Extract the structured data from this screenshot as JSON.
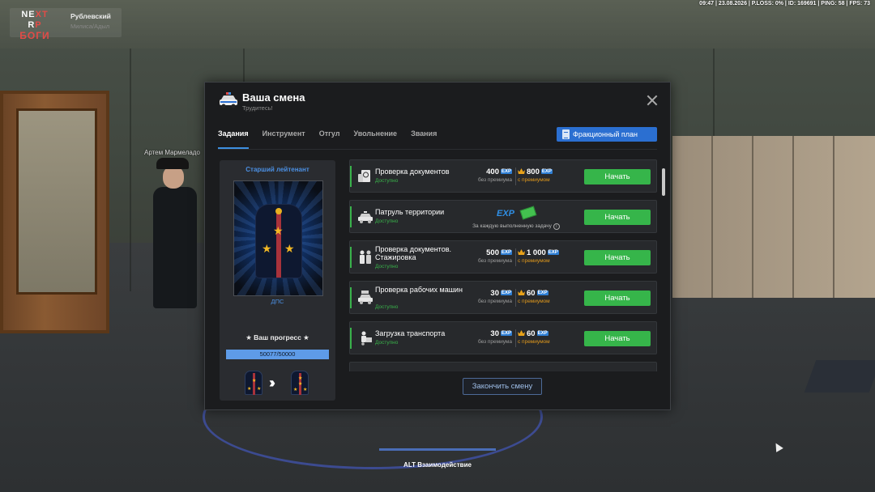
{
  "hud": {
    "status": "09:47 | 23.08.2026 | P.LOSS: 0% | ID: 169691 | PING: 58 | FPS: 73",
    "logo_top": "NEXT RP",
    "logo_bottom": "БОГИ",
    "city": "Рублевский",
    "district": "Милиса/Адыл",
    "npc_name": "Артем Мармеладо",
    "alt_hint": "ALT Взаимодействие"
  },
  "modal": {
    "title": "Ваша смена",
    "subtitle": "Трудитесь!",
    "tabs": [
      "Задания",
      "Инструмент",
      "Отгул",
      "Увольнение",
      "Звания"
    ],
    "faction_plan_label": "Фракционный план",
    "end_shift_label": "Закончить смену"
  },
  "rank": {
    "name": "Старший лейтенант",
    "unit": "ДПС",
    "progress_label": "★ Ваш прогресс ★",
    "progress_text": "50077/50000",
    "progress_fraction": 1.0
  },
  "tasks": [
    {
      "name": "Проверка документов",
      "status": "Доступно",
      "exp": "400",
      "exp_label": "без премиума",
      "premium_exp": "800",
      "premium_label": "с премиумом",
      "button": "Начать",
      "icon": "passport-icon"
    },
    {
      "name": "Патруль территории",
      "status": "Доступно",
      "exp_tag": "EXP",
      "note": "За каждую выполненную задачу",
      "button": "Начать",
      "icon": "police-car-icon"
    },
    {
      "name": "Проверка документов. Стажировка",
      "status": "Доступно",
      "exp": "500",
      "exp_label": "без премиума",
      "premium_exp": "1 000",
      "premium_label": "с премиумом",
      "button": "Начать",
      "icon": "officers-icon"
    },
    {
      "name": "Проверка рабочих машин",
      "status": "Доступно",
      "exp": "30",
      "exp_label": "без премиума",
      "premium_exp": "60",
      "premium_label": "с премиумом",
      "button": "Начать",
      "icon": "car-check-icon"
    },
    {
      "name": "Загрузка транспорта",
      "status": "Доступно",
      "exp": "30",
      "exp_label": "без премиума",
      "premium_exp": "60",
      "premium_label": "с премиумом",
      "button": "Начать",
      "icon": "loader-icon"
    }
  ],
  "labels": {
    "exp_tag": "EXP",
    "info_glyph": "i"
  },
  "colors": {
    "accent_blue": "#2b6fd1",
    "start_green": "#36b54a",
    "status_green": "#39b14a",
    "premium_orange": "#e39a1c"
  }
}
